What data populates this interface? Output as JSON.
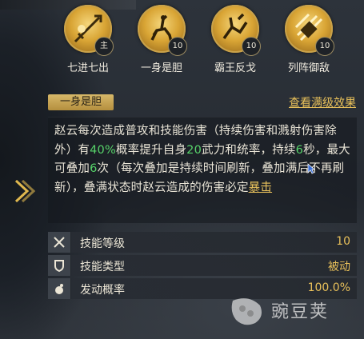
{
  "top_strip_text": "",
  "skills": [
    {
      "label": "七进七出",
      "badge": "主",
      "icon": "spear-icon"
    },
    {
      "label": "一身是胆",
      "badge": "10",
      "icon": "horse-rider-icon"
    },
    {
      "label": "霸王反戈",
      "badge": "10",
      "icon": "warrior-icon"
    },
    {
      "label": "列阵御敌",
      "badge": "10",
      "icon": "shield-formation-icon"
    }
  ],
  "detail": {
    "skill_name": "一身是胆",
    "view_max_link": "查看满级效果",
    "description": {
      "p1": "赵云每次造成普攻和技能伤害（持续伤害和溅射伤害除外）有",
      "pct": "40%",
      "p2": "概率提升自身",
      "stat": "20",
      "p3": "武力和统率，持续",
      "secs": "6",
      "p4": "秒，最大可叠加",
      "stacks": "6",
      "p5": "次（每次叠加是持续时间刷新，叠加满后不再刷新），叠满状态时赵云造成的伤害必定",
      "crit": "暴击"
    }
  },
  "stats": [
    {
      "label": "技能等级",
      "value": "10",
      "icon": "crossed-swords-icon"
    },
    {
      "label": "技能类型",
      "value": "被动",
      "icon": "shield-icon"
    },
    {
      "label": "发动概率",
      "value": "100.0%",
      "icon": "hand-icon"
    }
  ],
  "watermark": "豌豆荚",
  "colors": {
    "accent_gold": "#e8c05a",
    "highlight_green": "#57d46a"
  }
}
